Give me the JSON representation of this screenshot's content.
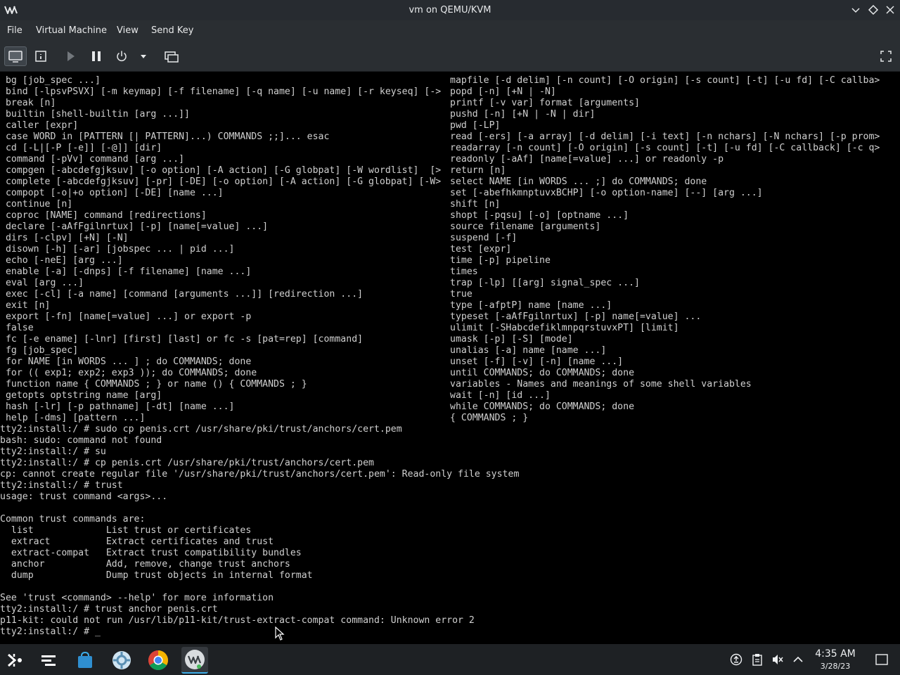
{
  "window": {
    "title": "vm on QEMU/KVM",
    "app_logo": "virt-manager-logo",
    "controls": [
      "minimize-icon",
      "maximize-icon",
      "close-icon"
    ]
  },
  "menubar": {
    "items": [
      "File",
      "Virtual Machine",
      "View",
      "Send Key"
    ]
  },
  "toolbar": {
    "buttons": [
      "console-icon",
      "details-icon",
      "run-icon",
      "pause-icon",
      "power-icon",
      "dropdown-icon",
      "snapshots-icon"
    ],
    "right_button": "fullscreen-icon"
  },
  "console": {
    "fg_color": "#d0d0d0",
    "bg_color": "#000000",
    "left_column": [
      " bg [job_spec ...]",
      " bind [-lpsvPSVX] [-m keymap] [-f filename] [-q name] [-u name] [-r keyseq] [->",
      " break [n]",
      " builtin [shell-builtin [arg ...]]",
      " caller [expr]",
      " case WORD in [PATTERN [| PATTERN]...) COMMANDS ;;]... esac",
      " cd [-L|[-P [-e]] [-@]] [dir]",
      " command [-pVv] command [arg ...]",
      " compgen [-abcdefgjksuv] [-o option] [-A action] [-G globpat] [-W wordlist]  [>",
      " complete [-abcdefgjksuv] [-pr] [-DE] [-o option] [-A action] [-G globpat] [-W>",
      " compopt [-o|+o option] [-DE] [name ...]",
      " continue [n]",
      " coproc [NAME] command [redirections]",
      " declare [-aAfFgilnrtux] [-p] [name[=value] ...]",
      " dirs [-clpv] [+N] [-N]",
      " disown [-h] [-ar] [jobspec ... | pid ...]",
      " echo [-neE] [arg ...]",
      " enable [-a] [-dnps] [-f filename] [name ...]",
      " eval [arg ...]",
      " exec [-cl] [-a name] [command [arguments ...]] [redirection ...]",
      " exit [n]",
      " export [-fn] [name[=value] ...] or export -p",
      " false",
      " fc [-e ename] [-lnr] [first] [last] or fc -s [pat=rep] [command]",
      " fg [job_spec]",
      " for NAME [in WORDS ... ] ; do COMMANDS; done",
      " for (( exp1; exp2; exp3 )); do COMMANDS; done",
      " function name { COMMANDS ; } or name () { COMMANDS ; }",
      " getopts optstring name [arg]",
      " hash [-lr] [-p pathname] [-dt] [name ...]",
      " help [-dms] [pattern ...]"
    ],
    "right_column": [
      "mapfile [-d delim] [-n count] [-O origin] [-s count] [-t] [-u fd] [-C callba>",
      "popd [-n] [+N | -N]",
      "printf [-v var] format [arguments]",
      "pushd [-n] [+N | -N | dir]",
      "pwd [-LP]",
      "read [-ers] [-a array] [-d delim] [-i text] [-n nchars] [-N nchars] [-p prom>",
      "readarray [-n count] [-O origin] [-s count] [-t] [-u fd] [-C callback] [-c q>",
      "readonly [-aAf] [name[=value] ...] or readonly -p",
      "return [n]",
      "select NAME [in WORDS ... ;] do COMMANDS; done",
      "set [-abefhkmnptuvxBCHP] [-o option-name] [--] [arg ...]",
      "shift [n]",
      "shopt [-pqsu] [-o] [optname ...]",
      "source filename [arguments]",
      "suspend [-f]",
      "test [expr]",
      "time [-p] pipeline",
      "times",
      "trap [-lp] [[arg] signal_spec ...]",
      "true",
      "type [-afptP] name [name ...]",
      "typeset [-aAfFgilnrtux] [-p] name[=value] ...",
      "ulimit [-SHabcdefiklmnpqrstuvxPT] [limit]",
      "umask [-p] [-S] [mode]",
      "unalias [-a] name [name ...]",
      "unset [-f] [-v] [-n] [name ...]",
      "until COMMANDS; do COMMANDS; done",
      "variables - Names and meanings of some shell variables",
      "wait [-n] [id ...]",
      "while COMMANDS; do COMMANDS; done",
      "{ COMMANDS ; }"
    ],
    "session_lines": [
      "tty2:install:/ # sudo cp penis.crt /usr/share/pki/trust/anchors/cert.pem",
      "bash: sudo: command not found",
      "tty2:install:/ # su",
      "tty2:install:/ # cp penis.crt /usr/share/pki/trust/anchors/cert.pem",
      "cp: cannot create regular file '/usr/share/pki/trust/anchors/cert.pem': Read-only file system",
      "tty2:install:/ # trust",
      "usage: trust command <args>...",
      "",
      "Common trust commands are:",
      "  list             List trust or certificates",
      "  extract          Extract certificates and trust",
      "  extract-compat   Extract trust compatibility bundles",
      "  anchor           Add, remove, change trust anchors",
      "  dump             Dump trust objects in internal format",
      "",
      "See 'trust <command> --help' for more information",
      "tty2:install:/ # trust anchor penis.crt",
      "p11-kit: could not run /usr/lib/p11-kit/trust-extract-compat command: Unknown error 2",
      "tty2:install:/ # _"
    ]
  },
  "taskbar": {
    "launcher": "application-launcher-icon",
    "tasks": [
      "task-manager-icon",
      "discover-store-icon",
      "settings-icon",
      "chrome-icon",
      "virt-manager-icon"
    ],
    "tray": [
      "tray-update-icon",
      "clipboard-icon",
      "volume-muted-icon",
      "tray-expand-icon"
    ],
    "clock_time": "4:35 AM",
    "clock_date": "3/28/23",
    "show_desktop": "show-desktop-icon",
    "accent": "#3daee9"
  }
}
